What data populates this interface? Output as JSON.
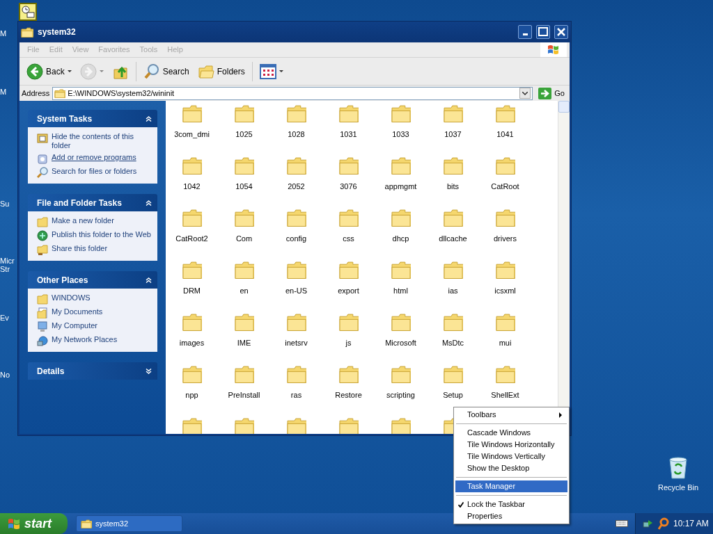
{
  "desktop": {
    "fragments": [
      "M",
      "M",
      "Su",
      "Micr",
      "Str",
      "Ev",
      "No"
    ],
    "icons": [
      {
        "label": "Recycle Bin"
      }
    ]
  },
  "window": {
    "title": "system32",
    "menu": [
      {
        "label": "File",
        "disabled": true
      },
      {
        "label": "Edit",
        "disabled": true
      },
      {
        "label": "View",
        "disabled": true
      },
      {
        "label": "Favorites",
        "disabled": true
      },
      {
        "label": "Tools",
        "disabled": true
      },
      {
        "label": "Help",
        "disabled": true
      }
    ],
    "toolbar": [
      {
        "kind": "back",
        "label": "Back",
        "disabled": false
      },
      {
        "kind": "forward",
        "disabled": true
      },
      {
        "kind": "up",
        "disabled": false
      },
      {
        "kind": "search",
        "label": "Search",
        "disabled": false
      },
      {
        "kind": "folders",
        "label": "Folders",
        "disabled": false
      },
      {
        "kind": "views",
        "disabled": false
      }
    ],
    "address": {
      "label": "Address",
      "value": "E:\\WINDOWS\\system32/wininit",
      "go": "Go"
    },
    "task_panes": [
      {
        "title": "System Tasks",
        "expanded": true,
        "items": [
          {
            "kind": "hide",
            "label": "Hide the contents of this folder",
            "hovered": false
          },
          {
            "kind": "programs",
            "label": "Add or remove programs",
            "hovered": true
          },
          {
            "kind": "search",
            "label": "Search for files or folders",
            "hovered": false
          }
        ]
      },
      {
        "title": "File and Folder Tasks",
        "expanded": true,
        "items": [
          {
            "kind": "newfolder",
            "label": "Make a new folder",
            "hovered": false
          },
          {
            "kind": "web",
            "label": "Publish this folder to the Web",
            "hovered": false
          },
          {
            "kind": "share",
            "label": "Share this folder",
            "hovered": false
          }
        ]
      },
      {
        "title": "Other Places",
        "expanded": true,
        "items": [
          {
            "kind": "folder",
            "label": "WINDOWS",
            "hovered": false
          },
          {
            "kind": "documents",
            "label": "My Documents",
            "hovered": false
          },
          {
            "kind": "computer",
            "label": "My Computer",
            "hovered": false
          },
          {
            "kind": "network",
            "label": "My Network Places",
            "hovered": false
          }
        ]
      },
      {
        "title": "Details",
        "expanded": false
      }
    ],
    "folders": [
      {
        "kind": "folder",
        "label": "3com_dmi"
      },
      {
        "kind": "folder",
        "label": "1025"
      },
      {
        "kind": "folder",
        "label": "1028"
      },
      {
        "kind": "folder",
        "label": "1031"
      },
      {
        "kind": "folder",
        "label": "1033"
      },
      {
        "kind": "folder",
        "label": "1037"
      },
      {
        "kind": "folder",
        "label": "1041"
      },
      {
        "kind": "folder",
        "label": "1042"
      },
      {
        "kind": "folder",
        "label": "1054"
      },
      {
        "kind": "folder",
        "label": "2052"
      },
      {
        "kind": "folder",
        "label": "3076"
      },
      {
        "kind": "folder",
        "label": "appmgmt"
      },
      {
        "kind": "folder",
        "label": "bits"
      },
      {
        "kind": "folder",
        "label": "CatRoot"
      },
      {
        "kind": "folder",
        "label": "CatRoot2"
      },
      {
        "kind": "folder",
        "label": "Com"
      },
      {
        "kind": "folder",
        "label": "config"
      },
      {
        "kind": "folder",
        "label": "css"
      },
      {
        "kind": "folder",
        "label": "dhcp"
      },
      {
        "kind": "folder",
        "label": "dllcache"
      },
      {
        "kind": "folder",
        "label": "drivers"
      },
      {
        "kind": "folder",
        "label": "DRM"
      },
      {
        "kind": "folder",
        "label": "en"
      },
      {
        "kind": "folder",
        "label": "en-US"
      },
      {
        "kind": "folder",
        "label": "export"
      },
      {
        "kind": "folder",
        "label": "html"
      },
      {
        "kind": "folder",
        "label": "ias"
      },
      {
        "kind": "folder",
        "label": "icsxml"
      },
      {
        "kind": "folder",
        "label": "images"
      },
      {
        "kind": "folder",
        "label": "IME"
      },
      {
        "kind": "folder",
        "label": "inetsrv"
      },
      {
        "kind": "folder",
        "label": "js"
      },
      {
        "kind": "folder",
        "label": "Microsoft"
      },
      {
        "kind": "folder",
        "label": "MsDtc"
      },
      {
        "kind": "folder",
        "label": "mui"
      },
      {
        "kind": "folder",
        "label": "npp"
      },
      {
        "kind": "folder",
        "label": "PreInstall"
      },
      {
        "kind": "folder",
        "label": "ras"
      },
      {
        "kind": "folder",
        "label": "Restore"
      },
      {
        "kind": "folder",
        "label": "scripting"
      },
      {
        "kind": "folder",
        "label": "Setup"
      },
      {
        "kind": "folder",
        "label": "ShellExt"
      },
      {
        "kind": "folder"
      },
      {
        "kind": "folder"
      },
      {
        "kind": "folder"
      },
      {
        "kind": "folder"
      },
      {
        "kind": "folder"
      },
      {
        "kind": "folder"
      }
    ]
  },
  "context_menu": [
    {
      "kind": "item",
      "label": "Toolbars",
      "submenu": true,
      "selected": false,
      "checked": false
    },
    {
      "kind": "separator"
    },
    {
      "kind": "item",
      "label": "Cascade Windows",
      "submenu": false,
      "selected": false,
      "checked": false
    },
    {
      "kind": "item",
      "label": "Tile Windows Horizontally",
      "submenu": false,
      "selected": false,
      "checked": false
    },
    {
      "kind": "item",
      "label": "Tile Windows Vertically",
      "submenu": false,
      "selected": false,
      "checked": false
    },
    {
      "kind": "item",
      "label": "Show the Desktop",
      "submenu": false,
      "selected": false,
      "checked": false
    },
    {
      "kind": "separator"
    },
    {
      "kind": "item",
      "label": "Task Manager",
      "submenu": false,
      "selected": true,
      "checked": false
    },
    {
      "kind": "separator"
    },
    {
      "kind": "item",
      "label": "Lock the Taskbar",
      "submenu": false,
      "selected": false,
      "checked": true
    },
    {
      "kind": "item",
      "label": "Properties",
      "submenu": false,
      "selected": false,
      "checked": false
    }
  ],
  "taskbar": {
    "start": "start",
    "tasks": [
      {
        "label": "system32",
        "selected": false
      }
    ],
    "clock": "10:17 AM"
  }
}
